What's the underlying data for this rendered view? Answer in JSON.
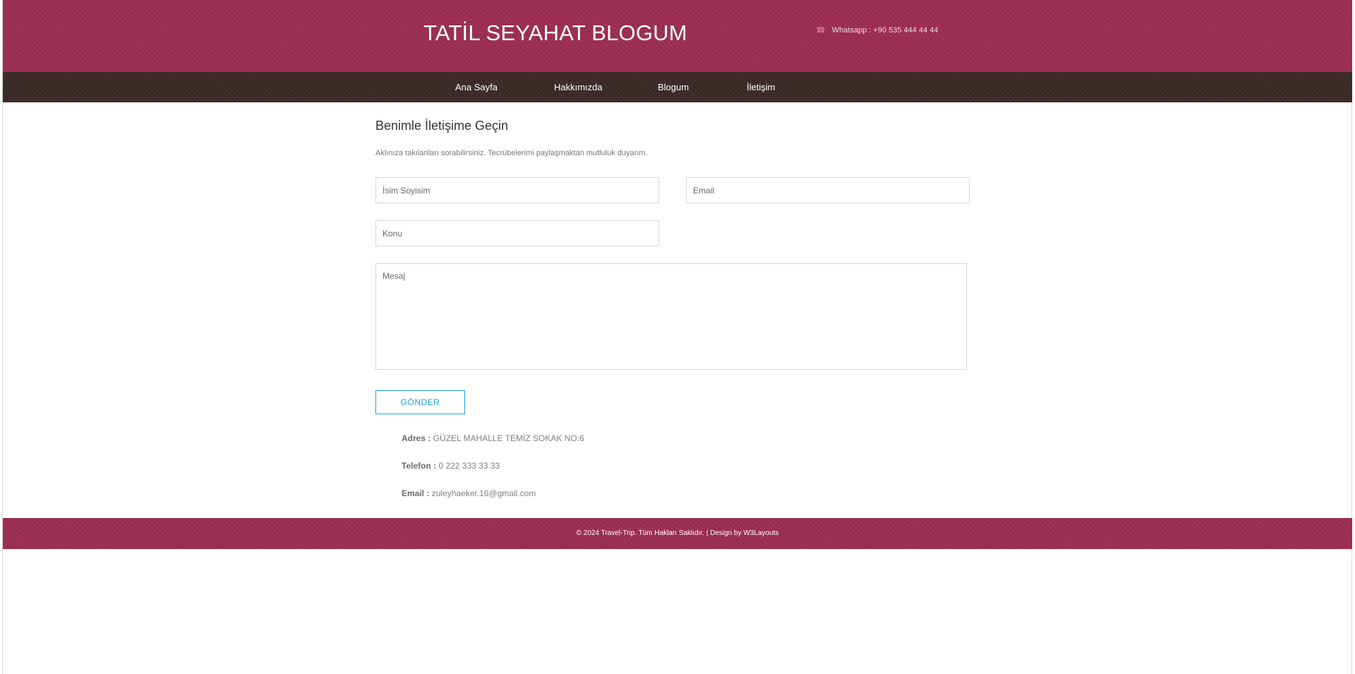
{
  "header": {
    "site_title": "TATİL SEYAHAT BLOGUM",
    "contact": "Whatsapp : +90 535 444 44 44",
    "contact_icon": "phone-icon",
    "bg_color": "#9c2d52"
  },
  "nav": {
    "items": [
      "Ana Sayfa",
      "Hakkımızda",
      "Blogum",
      "İletişim"
    ],
    "bg_color": "#3b2a27"
  },
  "contact_section": {
    "title": "Benimle İletişime Geçin",
    "subtitle": "Aklınıza takılanları sorabilirsiniz. Tecrübelerimi paylaşmaktan mutluluk duyarım.",
    "form": {
      "name_placeholder": "İsim Soyisim",
      "email_placeholder": "Email",
      "subject_placeholder": "Konu",
      "message_placeholder": "Mesaj",
      "submit_label": "GÖNDER"
    },
    "info": {
      "address_label": "Adres :",
      "address_value": "GÜZEL MAHALLE TEMİZ SOKAK NO:6",
      "phone_label": "Telefon :",
      "phone_value": "0 222 333 33 33",
      "email_label": "Email :",
      "email_value": "zuleyhaeker.16@gmail.com"
    }
  },
  "footer": {
    "text": "© 2024 Travel-Trip. Tüm Hakları Saklıdır. | Design by W3Layouts"
  },
  "colors": {
    "accent": "#9c2d52",
    "nav_dark": "#3b2a27",
    "button_blue": "#1e9fe1"
  }
}
